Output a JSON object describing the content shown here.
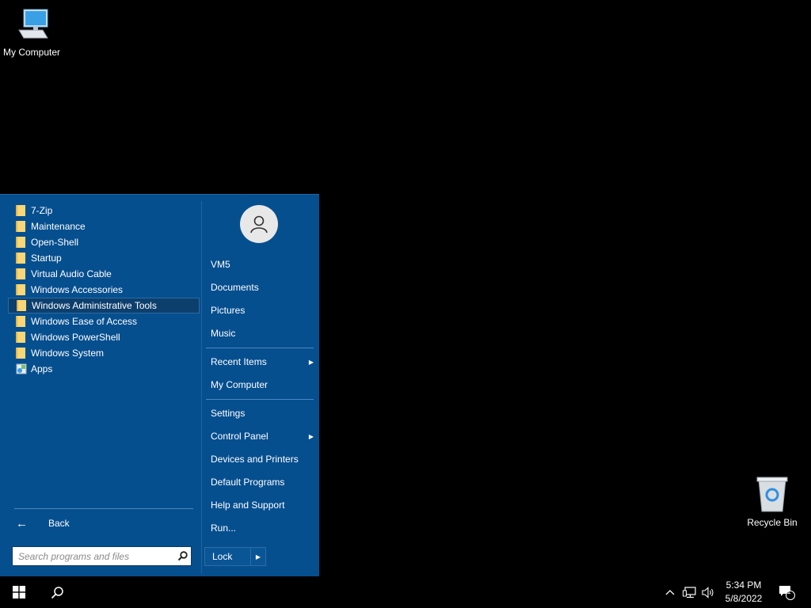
{
  "desktop": {
    "my_computer_label": "My Computer",
    "recycle_bin_label": "Recycle Bin"
  },
  "start_menu": {
    "programs": [
      {
        "label": "7-Zip",
        "icon": "folder-icon"
      },
      {
        "label": "Maintenance",
        "icon": "folder-icon"
      },
      {
        "label": "Open-Shell",
        "icon": "folder-icon"
      },
      {
        "label": "Startup",
        "icon": "folder-icon"
      },
      {
        "label": "Virtual Audio Cable",
        "icon": "folder-icon"
      },
      {
        "label": "Windows Accessories",
        "icon": "folder-icon"
      },
      {
        "label": "Windows Administrative Tools",
        "icon": "folder-icon",
        "highlighted": true
      },
      {
        "label": "Windows Ease of Access",
        "icon": "folder-icon"
      },
      {
        "label": "Windows PowerShell",
        "icon": "folder-icon"
      },
      {
        "label": "Windows System",
        "icon": "folder-icon"
      },
      {
        "label": "Apps",
        "icon": "apps-icon"
      }
    ],
    "back_label": "Back",
    "search_placeholder": "Search programs and files",
    "right": {
      "user": "VM5",
      "documents": "Documents",
      "pictures": "Pictures",
      "music": "Music",
      "recent_items": "Recent Items",
      "my_computer": "My Computer",
      "settings": "Settings",
      "control_panel": "Control Panel",
      "devices_printers": "Devices and Printers",
      "default_programs": "Default Programs",
      "help_support": "Help and Support",
      "run": "Run..."
    },
    "lock_label": "Lock"
  },
  "taskbar": {
    "time": "5:34 PM",
    "date": "5/8/2022",
    "notification_count": "1"
  },
  "colors": {
    "menu_bg": "#064f8f",
    "highlight": "#0d3f6d",
    "desktop_bg": "#000000"
  }
}
